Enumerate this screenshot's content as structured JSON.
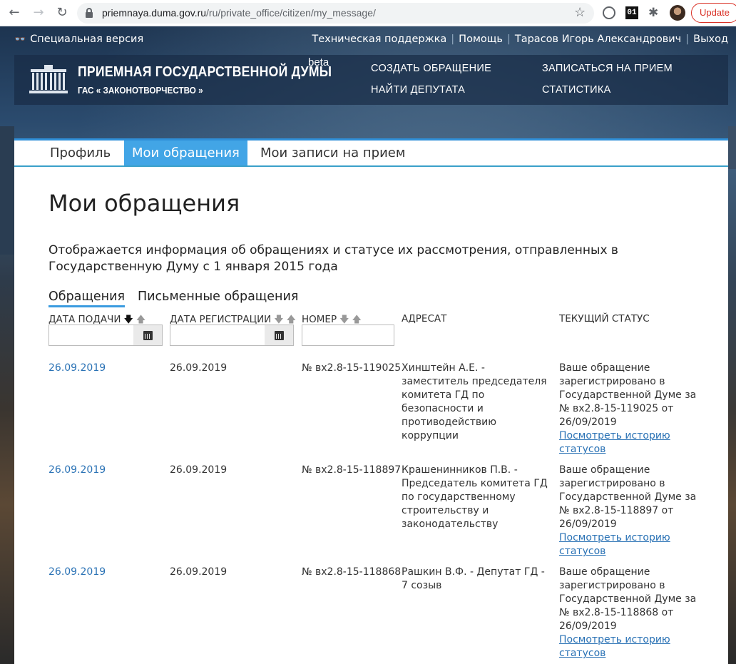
{
  "browser": {
    "url_domain": "priemnaya.duma.gov.ru",
    "url_path": "/ru/private_office/citizen/my_message/",
    "ext_01_label": "01",
    "update_label": "Update"
  },
  "topbar": {
    "special_version": "Специальная версия",
    "support": "Техническая поддержка",
    "help": "Помощь",
    "user": "Тарасов Игорь Александрович",
    "logout": "Выход"
  },
  "header": {
    "title": "ПРИЕМНАЯ ГОСУДАРСТВЕННОЙ ДУМЫ",
    "subtitle": "ГАС « ЗАКОНОТВОРЧЕСТВО »",
    "beta": "beta",
    "nav": {
      "create": "СОЗДАТЬ ОБРАЩЕНИЕ",
      "find": "НАЙТИ ДЕПУТАТА",
      "appointment": "ЗАПИСАТЬСЯ НА ПРИЕМ",
      "stats": "СТАТИСТИКА"
    }
  },
  "tabs": {
    "profile": "Профиль",
    "messages": "Мои обращения",
    "appointments": "Мои записи на прием"
  },
  "page": {
    "title": "Мои обращения",
    "intro": "Отображается информация об обращениях и статусе их рассмотрения, отправленных в Государственную Думу с 1 января 2015 года",
    "subtabs": {
      "requests": "Обращения",
      "written": "Письменные обращения"
    }
  },
  "table": {
    "headers": {
      "date_submit": "ДАТА ПОДАЧИ",
      "date_reg": "ДАТА РЕГИСТРАЦИИ",
      "number": "НОМЕР",
      "addressee": "АДРЕСАТ",
      "status": "ТЕКУЩИЙ СТАТУС"
    },
    "sort_down": "🡇",
    "sort_up": "🡅",
    "history_link": "Посмотреть историю статусов",
    "rows": [
      {
        "date_submit": "26.09.2019",
        "date_reg": "26.09.2019",
        "number": "№ вх2.8-15-119025",
        "addressee": "Хинштейн А.Е. - заместитель председателя комитета ГД по безопасности и противодействию коррупции",
        "status": "Ваше обращение зарегистрировано в Государственной Думе за № вх2.8-15-119025 от 26/09/2019"
      },
      {
        "date_submit": "26.09.2019",
        "date_reg": "26.09.2019",
        "number": "№ вх2.8-15-118897",
        "addressee": "Крашенинников П.В. - Председатель комитета ГД по государственному строительству и законодательству",
        "status": "Ваше обращение зарегистрировано в Государственной Думе за № вх2.8-15-118897 от 26/09/2019"
      },
      {
        "date_submit": "26.09.2019",
        "date_reg": "26.09.2019",
        "number": "№ вх2.8-15-118868",
        "addressee": "Рашкин В.Ф. - Депутат ГД - 7 созыв",
        "status": "Ваше обращение зарегистрировано в Государственной Думе за № вх2.8-15-118868 от 26/09/2019"
      }
    ]
  }
}
